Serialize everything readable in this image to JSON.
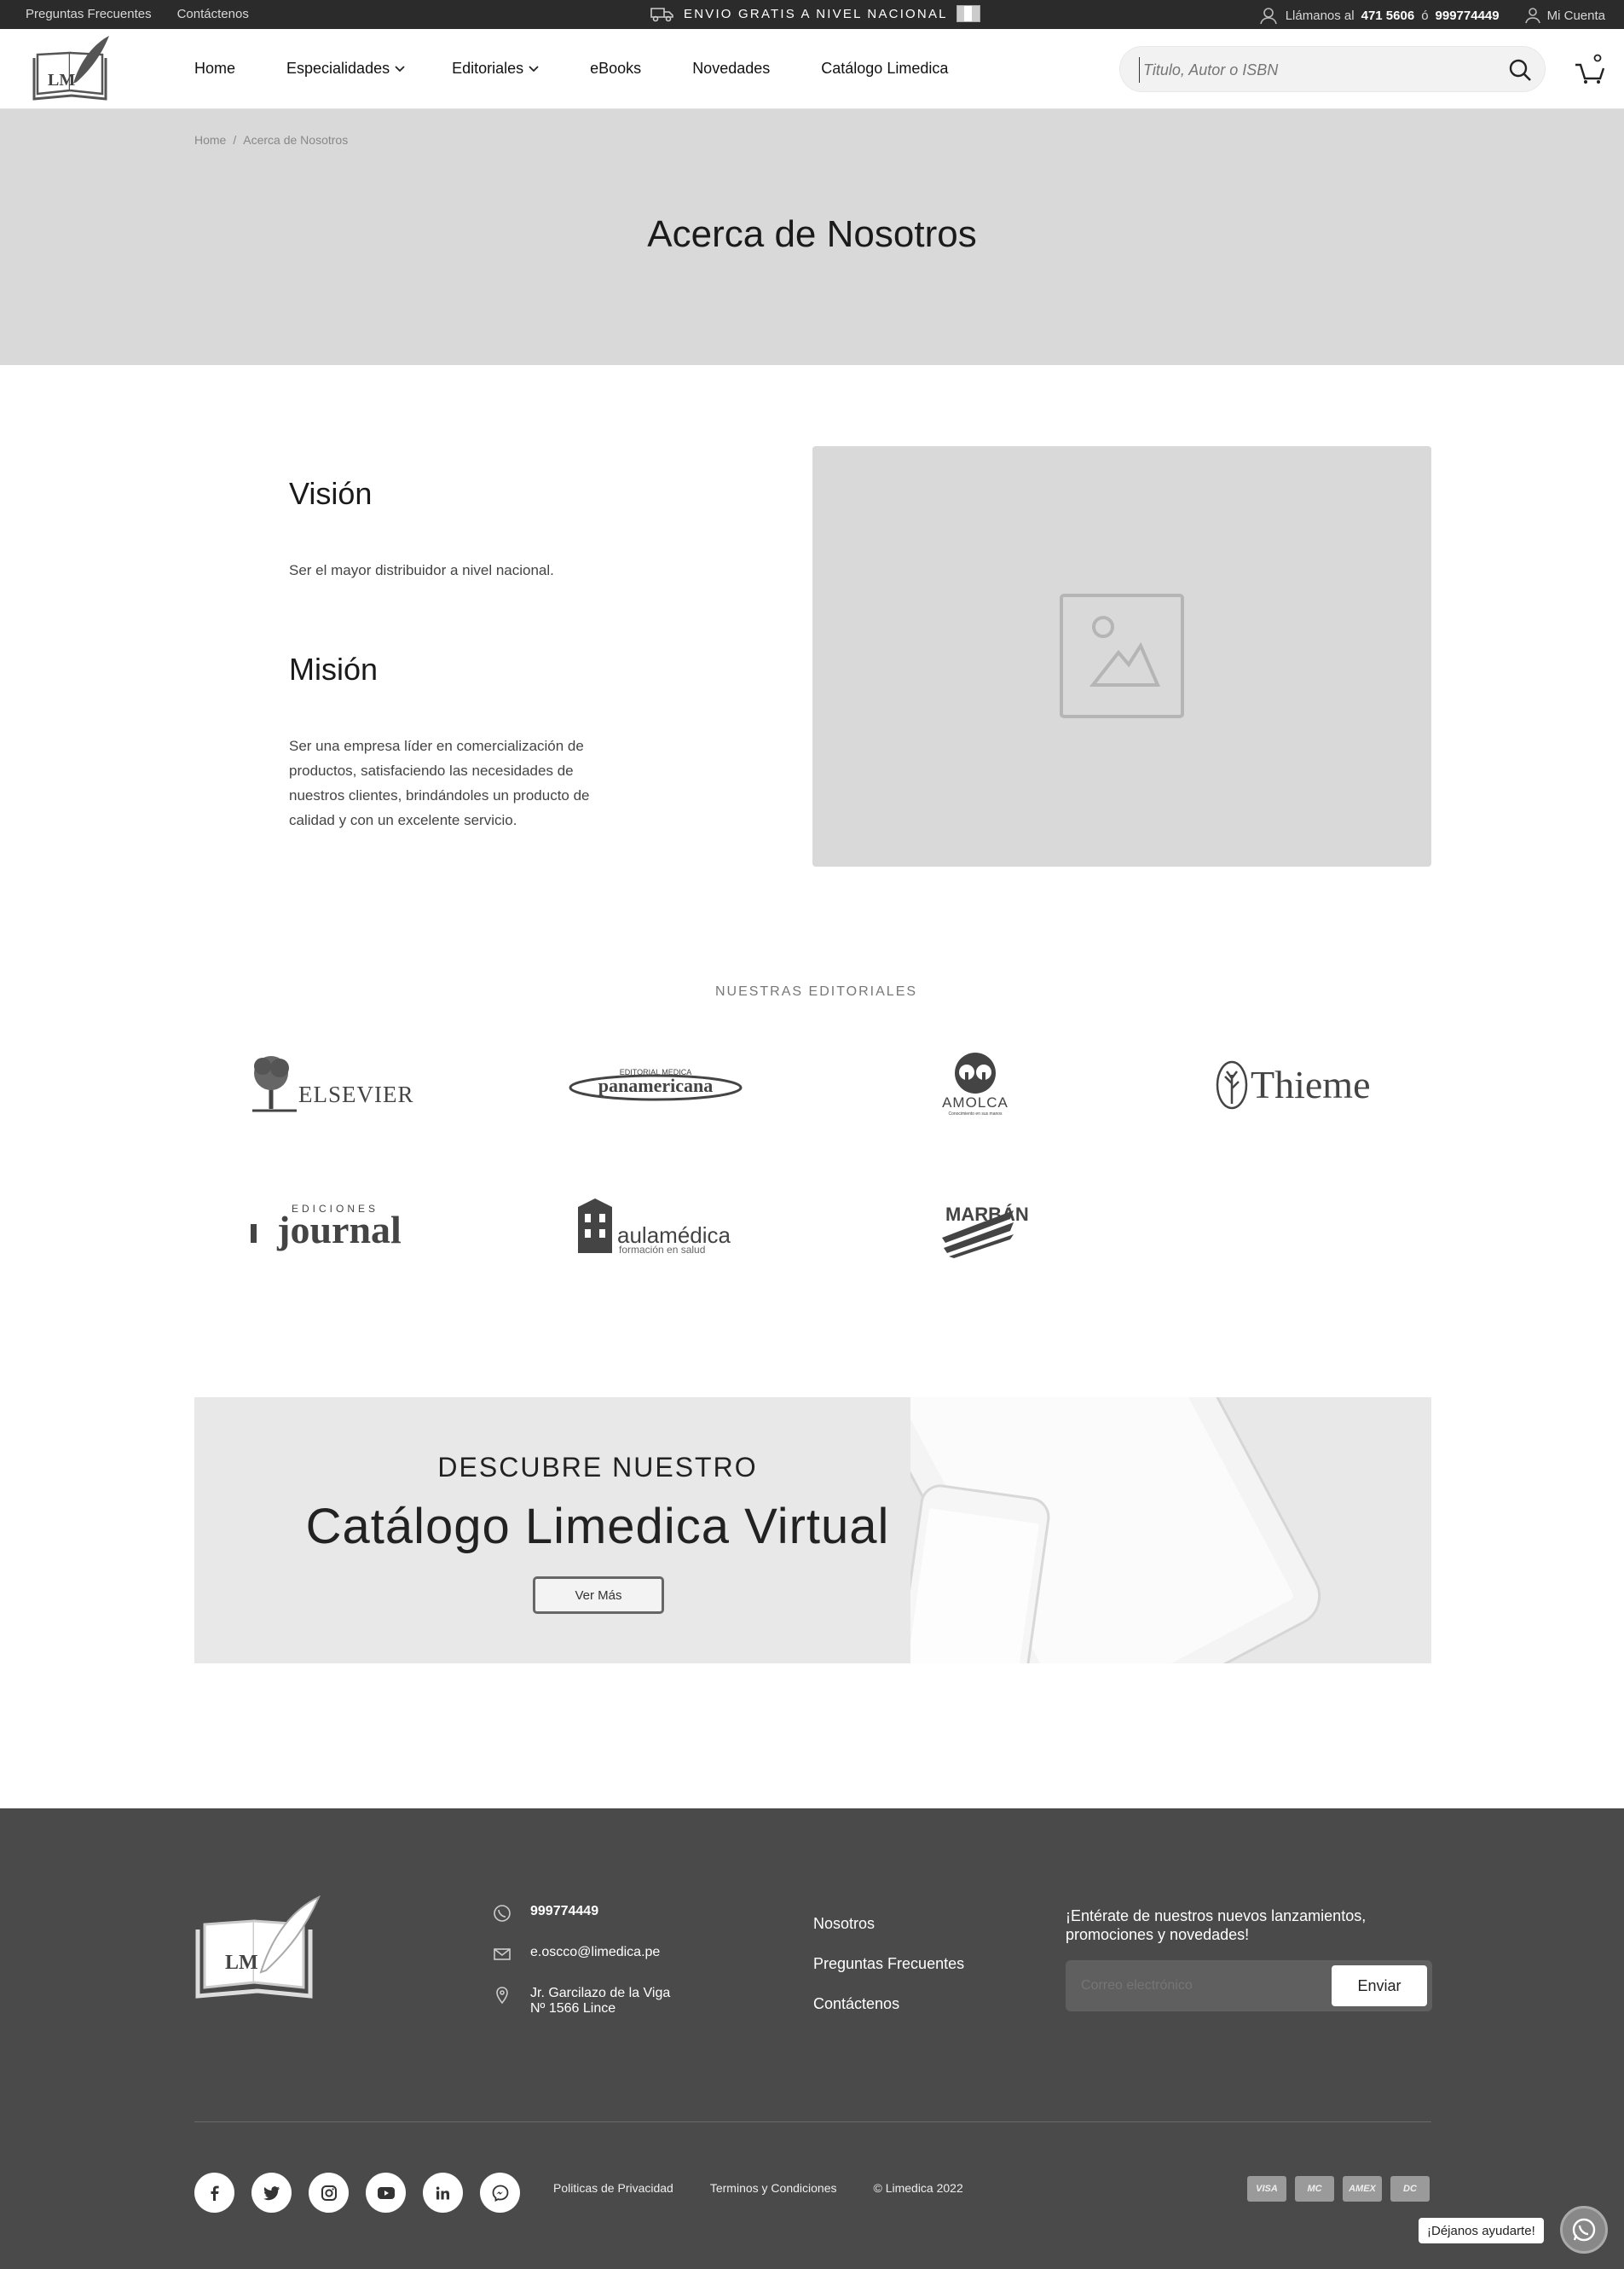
{
  "topbar": {
    "links": [
      "Preguntas Frecuentes",
      "Contáctenos"
    ],
    "promo": "ENVIO GRATIS A NIVEL NACIONAL",
    "call_prefix": "Llámanos al",
    "phone1": "471 5606",
    "or": "ó",
    "phone2": "999774449",
    "account": "Mi Cuenta"
  },
  "nav": {
    "items": [
      "Home",
      "Especialidades",
      "Editoriales",
      "eBooks",
      "Novedades",
      "Catálogo Limedica"
    ],
    "search_placeholder": "Titulo, Autor o ISBN"
  },
  "logo": {
    "letters": "LM"
  },
  "hero": {
    "breadcrumb": [
      "Home",
      "/",
      "Acerca de Nosotros"
    ],
    "title": "Acerca de Nosotros"
  },
  "about": {
    "vision_title": "Visión",
    "vision_text": "Ser el mayor distribuidor a nivel nacional.",
    "mision_title": "Misión",
    "mision_text": "Ser una empresa líder en comercialización de productos, satisfaciendo las necesidades de nuestros clientes, brindándoles un producto de calidad y con un excelente servicio."
  },
  "editoriales": {
    "title": "NUESTRAS EDITORIALES",
    "logos": [
      "ELSEVIER",
      "panamericana",
      "AMOLCA",
      "Thieme",
      "journal",
      "aulamédica",
      "MARBÁN"
    ],
    "logo_extra": {
      "panamericana_top": "EDITORIAL MEDICA",
      "amolca_tagline": "Conocimiento en sus manos",
      "journal_top": "EDICIONES",
      "aulamedica_tagline": "formación en salud"
    }
  },
  "banner": {
    "kicker": "DESCUBRE NUESTRO",
    "title": "Catálogo Limedica Virtual",
    "button": "Ver Más"
  },
  "footer": {
    "phone": "999774449",
    "email": "e.oscco@limedica.pe",
    "address_line1": "Jr. Garcilazo de la Viga",
    "address_line2": "Nº 1566 Lince",
    "links": [
      "Nosotros",
      "Preguntas Frecuentes",
      "Contáctenos"
    ],
    "newsletter_text": "¡Entérate de nuestros nuevos lanzamientos, promociones y novedades!",
    "email_placeholder": "Correo electrónico",
    "send_button": "Enviar",
    "legal": [
      "Politicas de Privacidad",
      "Terminos y Condiciones",
      "© Limedica 2022"
    ],
    "cards": [
      "VISA",
      "MC",
      "AMEX",
      "DC"
    ],
    "help": "¡Déjanos ayudarte!",
    "socials": [
      "facebook-icon",
      "twitter-icon",
      "instagram-icon",
      "youtube-icon",
      "linkedin-icon",
      "messenger-icon"
    ]
  }
}
